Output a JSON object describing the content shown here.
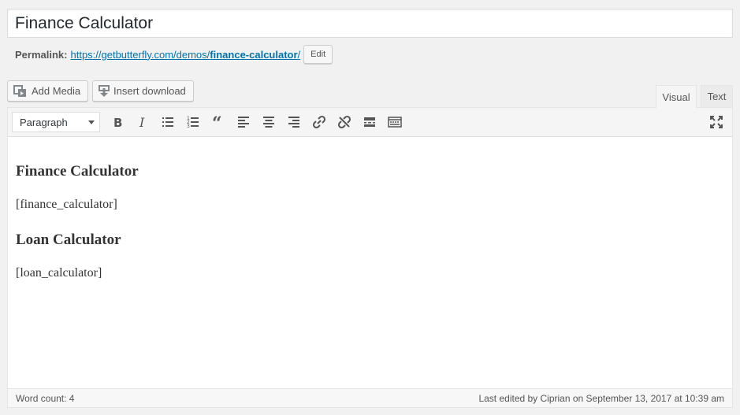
{
  "title": {
    "value": "Finance Calculator"
  },
  "permalink": {
    "label": "Permalink:",
    "url_prefix": "https://getbutterfly.com/demos/",
    "slug": "finance-calculator",
    "url_suffix": "/",
    "edit_label": "Edit"
  },
  "media_buttons": {
    "add_media": "Add Media",
    "insert_download": "Insert download"
  },
  "tabs": {
    "visual": "Visual",
    "text": "Text",
    "active": "Visual"
  },
  "toolbar": {
    "format_select": "Paragraph",
    "buttons": [
      "bold-icon",
      "italic-icon",
      "bullet-list-icon",
      "numbered-list-icon",
      "blockquote-icon",
      "align-left-icon",
      "align-center-icon",
      "align-right-icon",
      "link-icon",
      "unlink-icon",
      "read-more-icon",
      "toolbar-toggle-icon",
      "fullscreen-icon"
    ]
  },
  "content": {
    "heading1": "Finance Calculator",
    "shortcode1": "[finance_calculator]",
    "heading2": "Loan Calculator",
    "shortcode2": "[loan_calculator]"
  },
  "status": {
    "word_count": "Word count: 4",
    "last_edited": "Last edited by Ciprian on September 13, 2017 at 10:39 am"
  },
  "colors": {
    "link": "#0073aa",
    "background": "#f1f1f1",
    "text": "#23282d"
  }
}
